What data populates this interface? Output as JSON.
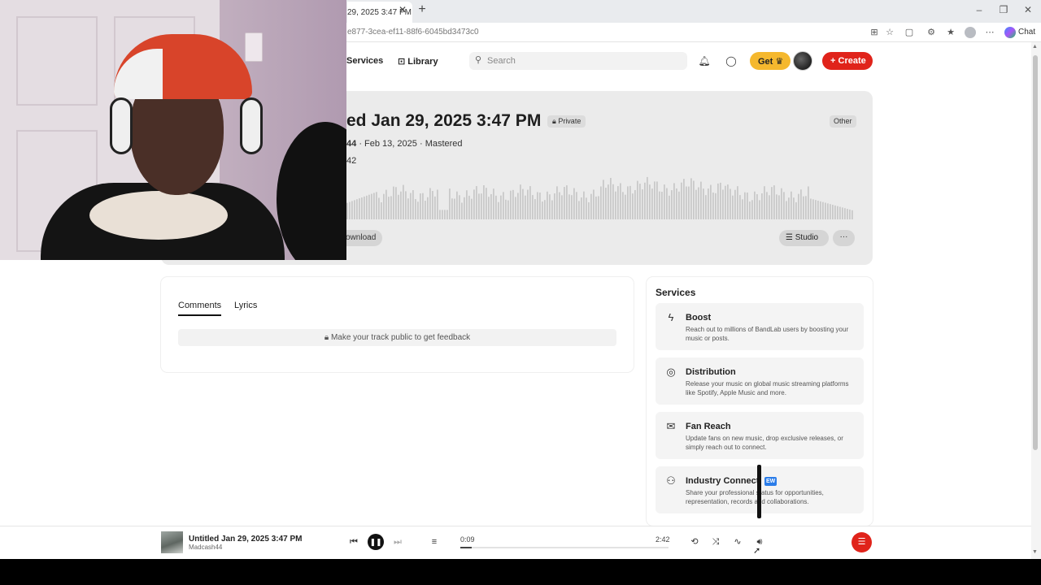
{
  "browser": {
    "tab_title": "29, 2025 3:47 PM",
    "tab_close": "✕",
    "new_tab": "+",
    "url": "e877-3cea-ef11-88f6-6045bd3473c0",
    "chat_label": "Chat",
    "window_controls": [
      "–",
      "❐",
      "✕"
    ]
  },
  "header": {
    "nav": [
      {
        "label": "Services"
      },
      {
        "label": "Library"
      }
    ],
    "search_placeholder": "Search",
    "get_label": "Get",
    "create_label": "Create"
  },
  "track": {
    "title": "ed Jan 29, 2025 3:47 PM",
    "privacy": "Private",
    "genre": "Other",
    "artist_fragment": "44",
    "date": "Feb 13, 2025",
    "status": "Mastered",
    "separator": "·",
    "duration_fragment": "42",
    "download_label": "ownload",
    "studio_label": "Studio",
    "more_label": "···"
  },
  "comments": {
    "tabs": [
      "Comments",
      "Lyrics"
    ],
    "active_tab": "Comments",
    "notice": "Make your track public to get feedback"
  },
  "services": {
    "title": "Services",
    "items": [
      {
        "name": "Boost",
        "icon": "lightning-icon",
        "description": "Reach out to millions of BandLab users by boosting your music or posts."
      },
      {
        "name": "Distribution",
        "icon": "distribution-icon",
        "description": "Release your music on global music streaming platforms like Spotify, Apple Music and more."
      },
      {
        "name": "Fan Reach",
        "icon": "envelope-icon",
        "description": "Update fans on new music, drop exclusive releases, or simply reach out to connect."
      },
      {
        "name": "Industry Connect",
        "icon": "people-icon",
        "badge": "EW",
        "description": "Share your professional status for opportunities, representation, records and collaborations."
      }
    ]
  },
  "player": {
    "title": "Untitled Jan 29, 2025 3:47 PM",
    "artist": "Madcash44",
    "current_time": "0:09",
    "total_time": "2:42",
    "progress": 0.056
  },
  "colors": {
    "accent_red": "#e0231a",
    "get_yellow": "#f5b82e",
    "new_blue": "#2b7de9"
  }
}
